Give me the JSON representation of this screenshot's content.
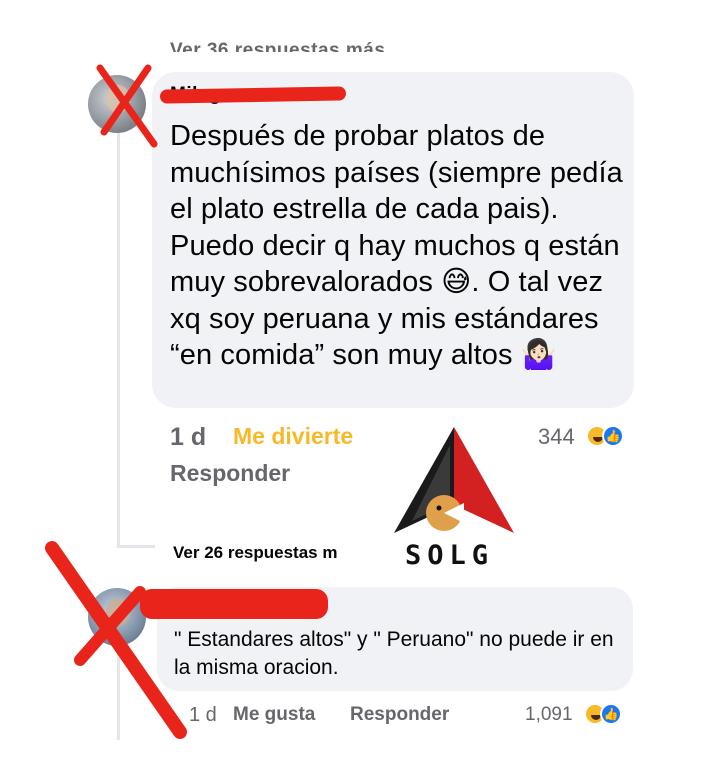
{
  "thread": {
    "top_view_replies": "Ver 36 respuestas más...",
    "comment1": {
      "author": "Milagros",
      "text": "Después de probar platos de muchísimos países  (siempre pedía el plato estrella de cada pais). Puedo decir q hay muchos q están muy sobrevalorados 😅. O tal vez xq soy peruana y mis estándares “en comida” son muy altos 🤷🏻‍♀️",
      "time": "1 d",
      "reaction_label": "Me divierte",
      "reply_label": "Responder",
      "reaction_count": "344"
    },
    "view_replies": "Ver 26 respuestas m",
    "comment2": {
      "text": "\" Estandares altos\" y \" Peruano\" no puede ir en la misma oracion.",
      "time": "1 d",
      "like_label": "Me gusta",
      "reply_label": "Responder",
      "reaction_count": "1,091"
    }
  },
  "watermark": {
    "text": "SOLG"
  },
  "colors": {
    "bubble": "#f0f2f5",
    "meta_gray": "#65676b",
    "haha_yellow": "#f7b928",
    "like_blue": "#1877f2",
    "censor_red": "#e8241b"
  },
  "icons": {
    "haha": "haha-reaction-icon",
    "like": "like-reaction-icon"
  }
}
